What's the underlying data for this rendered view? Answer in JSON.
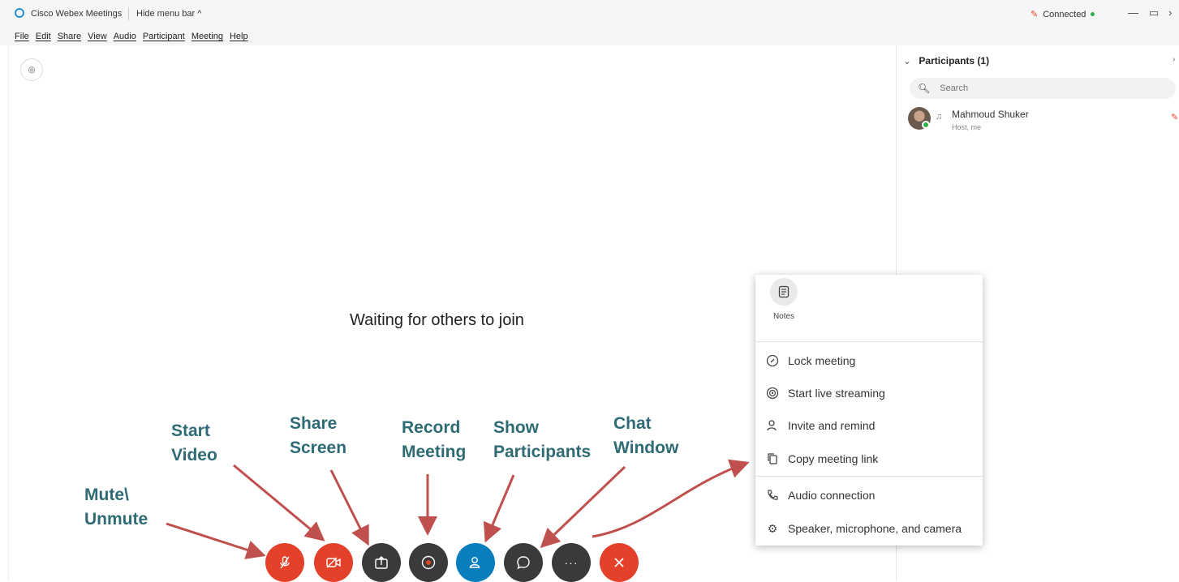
{
  "window": {
    "app_title": "Cisco Webex Meetings",
    "hide_menu_bar": "Hide menu bar ^",
    "status": "Connected",
    "minimize": "—",
    "restore": "▭",
    "close_partial": "›"
  },
  "menu": [
    "File",
    "Edit",
    "Share",
    "View",
    "Audio",
    "Participant",
    "Meeting",
    "Help"
  ],
  "stage": {
    "waiting_text": "Waiting for others to join"
  },
  "participants": {
    "header": "Participants (1)",
    "search_placeholder": "Search",
    "list": [
      {
        "name": "Mahmoud Shuker",
        "role": "Host, me"
      }
    ]
  },
  "popup": {
    "notes_label": "Notes",
    "items": [
      {
        "label": "Lock meeting",
        "icon": "lock-icon"
      },
      {
        "label": "Start live streaming",
        "icon": "live-streaming-icon"
      },
      {
        "label": "Invite and remind",
        "icon": "invite-person-icon"
      },
      {
        "label": "Copy meeting link",
        "icon": "copy-icon"
      },
      {
        "label": "Audio connection",
        "icon": "phone-icon"
      },
      {
        "label": "Speaker, microphone, and camera",
        "icon": "gear-icon"
      }
    ]
  },
  "controls": [
    {
      "name": "mute-button",
      "icon": "mic-muted-icon",
      "color": "#e3412a"
    },
    {
      "name": "start-video-button",
      "icon": "video-off-icon",
      "color": "#e3412a"
    },
    {
      "name": "share-screen-button",
      "icon": "share-icon",
      "color": "#3a3a3a"
    },
    {
      "name": "record-button",
      "icon": "record-icon",
      "color": "#3a3a3a"
    },
    {
      "name": "participants-button",
      "icon": "participants-icon",
      "color": "#0a7dbc"
    },
    {
      "name": "chat-button",
      "icon": "chat-icon",
      "color": "#3a3a3a"
    },
    {
      "name": "more-options-button",
      "icon": "more-icon",
      "color": "#3a3a3a"
    },
    {
      "name": "leave-meeting-button",
      "icon": "close-icon",
      "color": "#e3412a"
    }
  ],
  "annotations": {
    "mute_line1": "Mute\\",
    "mute_line2": "Unmute",
    "video_line1": "Start",
    "video_line2": "Video",
    "share_line1": "Share",
    "share_line2": "Screen",
    "record_line1": "Record",
    "record_line2": "Meeting",
    "participants_line1": "Show",
    "participants_line2": "Participants",
    "chat_line1": "Chat",
    "chat_line2": "Window"
  },
  "colors": {
    "accent_red": "#e3412a",
    "accent_blue": "#0a7dbc",
    "annotation_text": "#2e6b74",
    "arrow": "#c0504d"
  }
}
